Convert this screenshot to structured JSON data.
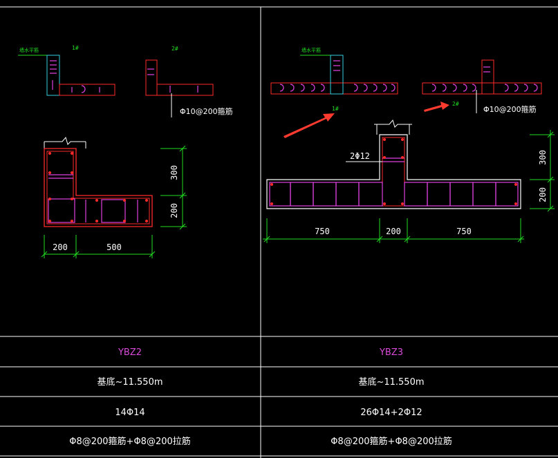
{
  "colors": {
    "background": "#000000",
    "grid": "#ffffff",
    "outline": "#ff2a2a",
    "stirrup": "#e040e0",
    "dimension": "#22dd22",
    "cyan": "#33d0e0",
    "label_magenta": "#d84ad8",
    "arrow": "#ff3b2f"
  },
  "left": {
    "detail1_caption": "1#",
    "detail1_note": "墙水平筋",
    "detail2_caption": "2#",
    "callout": "Φ10@200箍筋",
    "dims": {
      "vertical": [
        "300",
        "200"
      ],
      "horizontal": [
        "200",
        "500"
      ]
    }
  },
  "right": {
    "detail1_caption": "1#",
    "detail1_note": "墙水平筋",
    "detail2_caption": "2#",
    "callout": "Φ10@200箍筋",
    "bar_label": "2Φ12",
    "dims": {
      "vertical": [
        "300",
        "200"
      ],
      "horizontal": [
        "750",
        "200",
        "750"
      ]
    }
  },
  "table": {
    "rows": [
      [
        "YBZ2",
        "YBZ3"
      ],
      [
        "基底~11.550m",
        "基底~11.550m"
      ],
      [
        "14Φ14",
        "26Φ14+2Φ12"
      ],
      [
        "Φ8@200箍筋+Φ8@200拉筋",
        "Φ8@200箍筋+Φ8@200拉筋"
      ]
    ]
  }
}
